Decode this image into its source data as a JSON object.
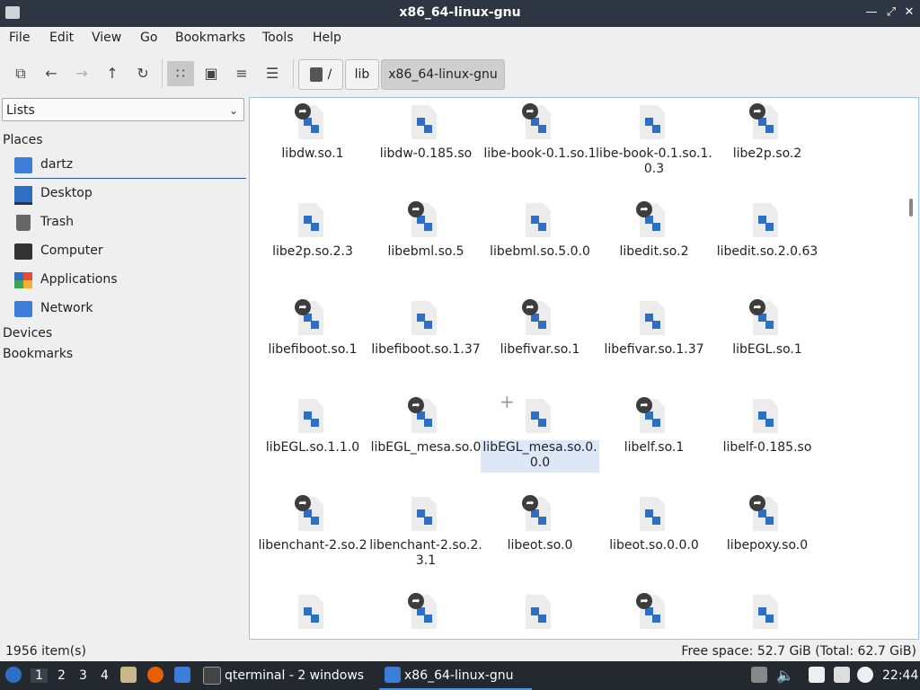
{
  "window": {
    "title": "x86_64-linux-gnu"
  },
  "menu": [
    "File",
    "Edit",
    "View",
    "Go",
    "Bookmarks",
    "Tools",
    "Help"
  ],
  "path": [
    "/",
    "lib",
    "x86_64-linux-gnu"
  ],
  "sidebar": {
    "combo": "Lists",
    "places_title": "Places",
    "places": [
      "dartz",
      "Desktop",
      "Trash",
      "Computer",
      "Applications",
      "Network"
    ],
    "devices_title": "Devices",
    "bookmarks_title": "Bookmarks"
  },
  "files": [
    {
      "name": "libdw.so.1",
      "link": true
    },
    {
      "name": "libdw-0.185.so",
      "link": false
    },
    {
      "name": "libe-book-0.1.so.1",
      "link": true
    },
    {
      "name": "libe-book-0.1.so.1.0.3",
      "link": false
    },
    {
      "name": "libe2p.so.2",
      "link": true
    },
    {
      "name": "libe2p.so.2.3",
      "link": false
    },
    {
      "name": "libebml.so.5",
      "link": true
    },
    {
      "name": "libebml.so.5.0.0",
      "link": false
    },
    {
      "name": "libedit.so.2",
      "link": true
    },
    {
      "name": "libedit.so.2.0.63",
      "link": false
    },
    {
      "name": "libefiboot.so.1",
      "link": true
    },
    {
      "name": "libefiboot.so.1.37",
      "link": false
    },
    {
      "name": "libefivar.so.1",
      "link": true
    },
    {
      "name": "libefivar.so.1.37",
      "link": false
    },
    {
      "name": "libEGL.so.1",
      "link": true
    },
    {
      "name": "libEGL.so.1.1.0",
      "link": false
    },
    {
      "name": "libEGL_mesa.so.0",
      "link": true
    },
    {
      "name": "libEGL_mesa.so.0.0.0",
      "link": false,
      "selected": true
    },
    {
      "name": "libelf.so.1",
      "link": true
    },
    {
      "name": "libelf-0.185.so",
      "link": false
    },
    {
      "name": "libenchant-2.so.2",
      "link": true
    },
    {
      "name": "libenchant-2.so.2.3.1",
      "link": false
    },
    {
      "name": "libeot.so.0",
      "link": true
    },
    {
      "name": "libeot.so.0.0.0",
      "link": false
    },
    {
      "name": "libepoxy.so.0",
      "link": true
    },
    {
      "name": "",
      "link": false
    },
    {
      "name": "",
      "link": true
    },
    {
      "name": "",
      "link": false
    },
    {
      "name": "",
      "link": true
    },
    {
      "name": "",
      "link": false
    }
  ],
  "status": {
    "count": "1956 item(s)",
    "space": "Free space: 52.7 GiB (Total: 62.7 GiB)"
  },
  "taskbar": {
    "workspaces": [
      "1",
      "2",
      "3",
      "4"
    ],
    "apps": [
      "qterminal - 2 windows",
      "x86_64-linux-gnu"
    ],
    "clock": "22:44"
  },
  "colors": {
    "accent": "#2f6fc3",
    "titlebar": "#2d3642",
    "taskbar": "#23292f"
  }
}
